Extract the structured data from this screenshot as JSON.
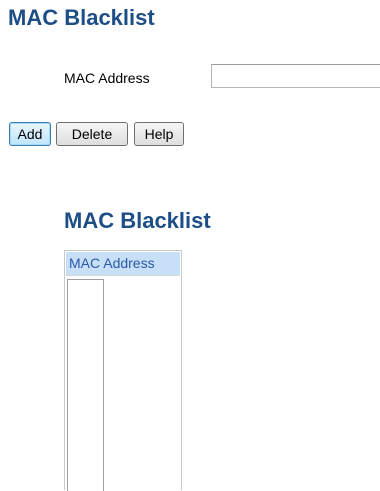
{
  "page_title": "MAC Blacklist",
  "form": {
    "mac_label": "MAC Address",
    "mac_value": "",
    "mac_placeholder": ""
  },
  "buttons": {
    "add": "Add",
    "delete": "Delete",
    "help": "Help"
  },
  "list": {
    "title": "MAC Blacklist",
    "header": "MAC Address",
    "entries": []
  }
}
